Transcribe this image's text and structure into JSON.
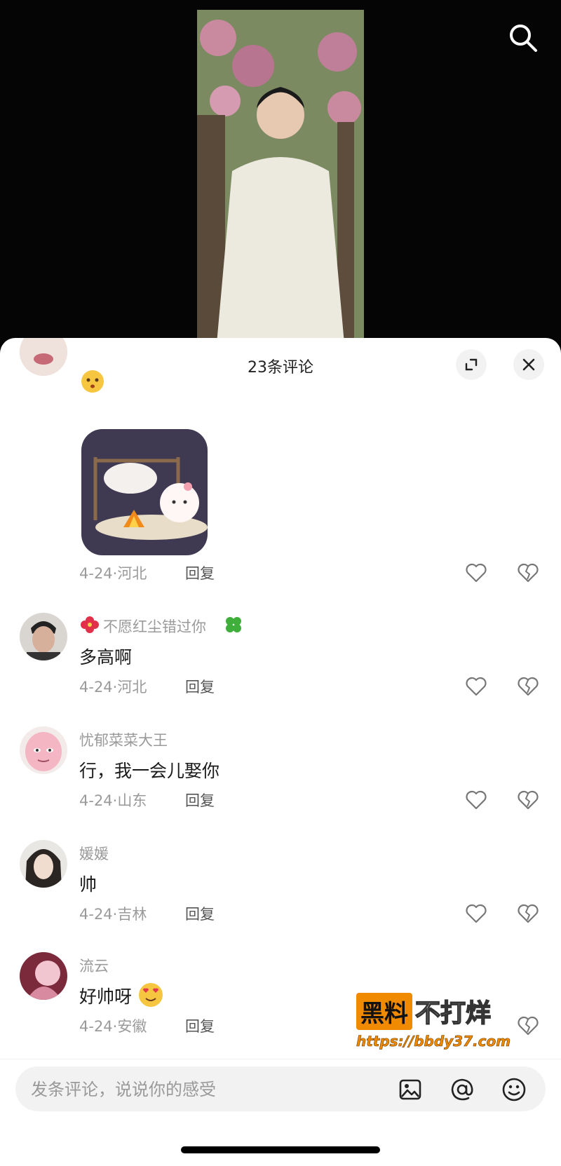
{
  "sheet": {
    "title": "23条评论"
  },
  "comments": [
    {
      "name": "",
      "text": "",
      "date": "4-24·河北",
      "reply": "回复"
    },
    {
      "name": "不愿红尘错过你",
      "text": "多高啊",
      "date": "4-24·河北",
      "reply": "回复"
    },
    {
      "name": "忧郁菜菜大王",
      "text": "行，我一会儿娶你",
      "date": "4-24·山东",
      "reply": "回复"
    },
    {
      "name": "媛媛",
      "text": "帅",
      "date": "4-24·吉林",
      "reply": "回复"
    },
    {
      "name": "流云",
      "text": "好帅呀",
      "date": "4-24·安徽",
      "reply": "回复"
    }
  ],
  "input": {
    "placeholder": "发条评论，说说你的感受"
  },
  "watermark": {
    "box": "黑料",
    "text": "不打烊",
    "url": "https://bbdy37.com"
  },
  "icons": [
    "search-icon",
    "expand-icon",
    "close-icon",
    "heart-icon",
    "broken-heart-icon",
    "image-icon",
    "at-icon",
    "emoji-icon"
  ]
}
